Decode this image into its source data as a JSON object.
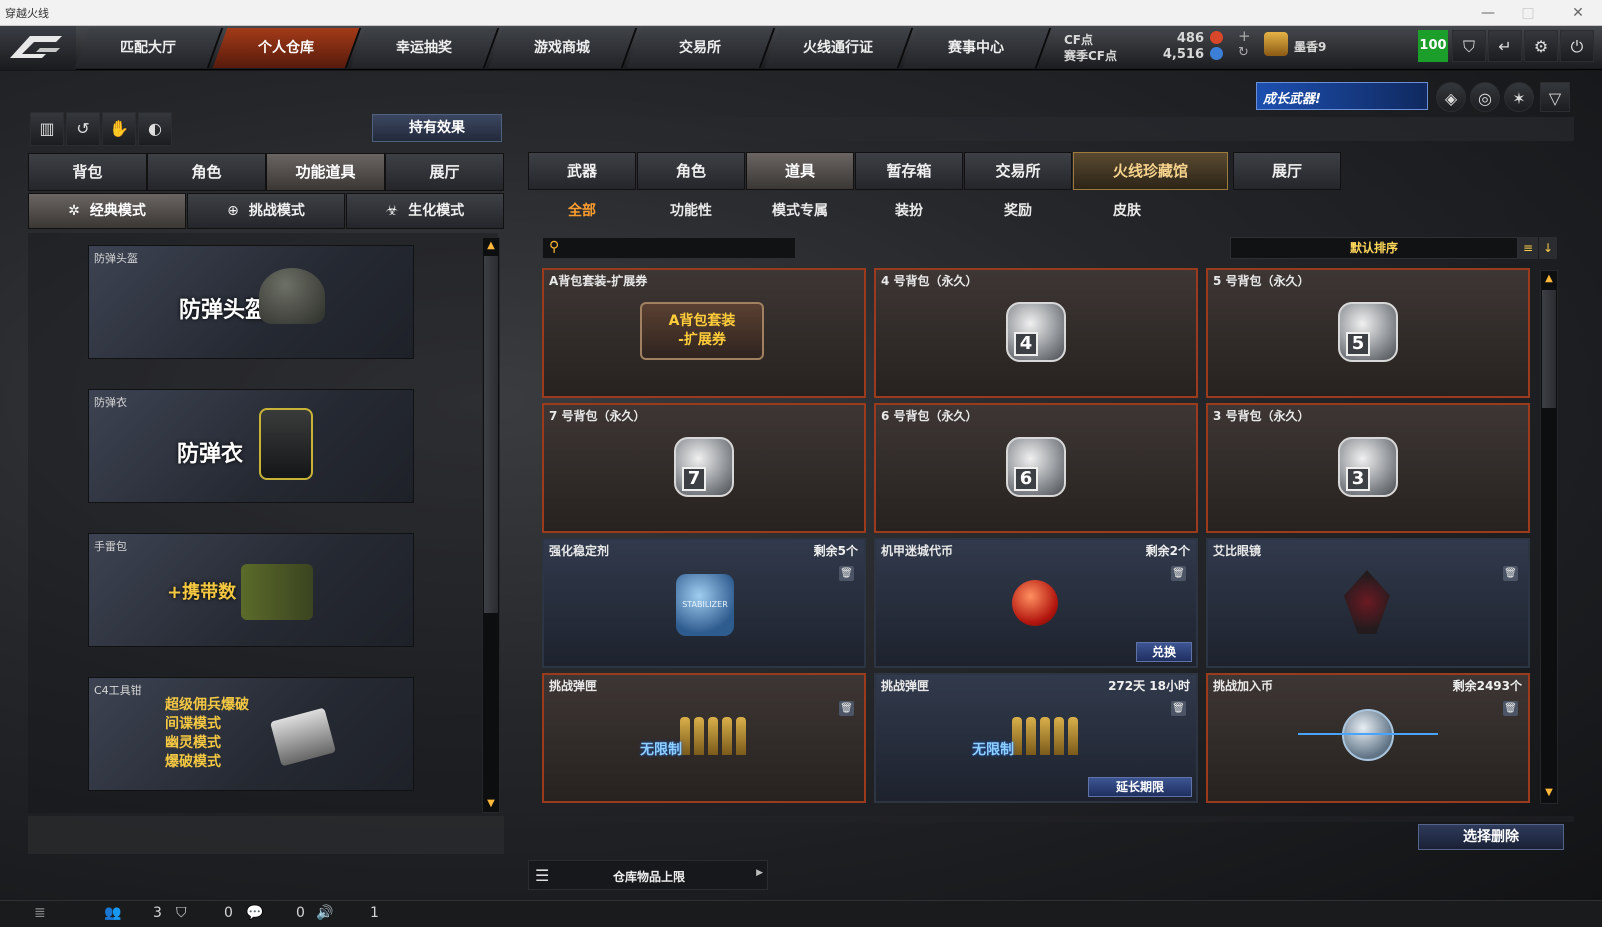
{
  "window": {
    "title": "穿越火线"
  },
  "nav": {
    "tabs": [
      "匹配大厅",
      "个人仓库",
      "幸运抽奖",
      "游戏商城",
      "交易所",
      "火线通行证",
      "赛事中心"
    ],
    "active": "个人仓库"
  },
  "currency": {
    "cf_label": "CF点",
    "cf_value": "486",
    "season_label": "赛季CF点",
    "season_value": "4,516"
  },
  "player": {
    "name": "墨香9",
    "level_badge": "100"
  },
  "banner": {
    "text": "成长武器!"
  },
  "left": {
    "effect_button": "持有效果",
    "tabs": [
      "背包",
      "角色",
      "功能道具",
      "展厅"
    ],
    "active_tab": "功能道具",
    "modes": [
      "经典模式",
      "挑战模式",
      "生化模式"
    ],
    "active_mode": "经典模式",
    "cards": [
      {
        "caption": "防弹头盔",
        "title": "防弹头盔"
      },
      {
        "caption": "防弹衣",
        "title": "防弹衣"
      },
      {
        "caption": "手雷包",
        "title": "+携带数"
      },
      {
        "caption": "C4工具钳",
        "title_lines": [
          "超级佣兵爆破",
          "间谍模式",
          "幽灵模式",
          "爆破模式"
        ]
      }
    ]
  },
  "right": {
    "tabs": [
      "武器",
      "角色",
      "道具",
      "暂存箱",
      "交易所",
      "火线珍藏馆",
      "展厅"
    ],
    "active_tab": "道具",
    "highlight_tab": "火线珍藏馆",
    "subtabs": [
      "全部",
      "功能性",
      "模式专属",
      "装扮",
      "奖励",
      "皮肤"
    ],
    "active_subtab": "全部",
    "search_placeholder": "",
    "sort_label": "默认排序",
    "items": [
      {
        "caption": "A背包套装-扩展券",
        "icon_text": "A背包套装\n-扩展券",
        "style": "red"
      },
      {
        "caption": "4 号背包（永久）",
        "bag": "4",
        "style": "red"
      },
      {
        "caption": "5 号背包（永久）",
        "bag": "5",
        "style": "red"
      },
      {
        "caption": "7 号背包（永久）",
        "bag": "7",
        "style": "red"
      },
      {
        "caption": "6 号背包（永久）",
        "bag": "6",
        "style": "red"
      },
      {
        "caption": "3 号背包（永久）",
        "bag": "3",
        "style": "red"
      },
      {
        "caption": "强化稳定剂",
        "count": "剩余5个",
        "icon_text": "STABILIZER",
        "style": "blue"
      },
      {
        "caption": "机甲迷城代币",
        "count": "剩余2个",
        "action": "兑换",
        "style": "blue"
      },
      {
        "caption": "艾比眼镜",
        "style": "blue"
      },
      {
        "caption": "挑战弹匣",
        "icon_text": "无限制",
        "style": "red"
      },
      {
        "caption": "挑战弹匣",
        "count": "272天 18小时",
        "icon_text": "无限制",
        "action": "延长期限",
        "style": "blue"
      },
      {
        "caption": "挑战加入币",
        "count": "剩余2493个",
        "style": "red"
      }
    ],
    "delete_button": "选择删除",
    "storage_label": "仓库物品上限"
  },
  "status": {
    "v1": "3",
    "v2": "0",
    "v3": "0",
    "v4": "1"
  }
}
